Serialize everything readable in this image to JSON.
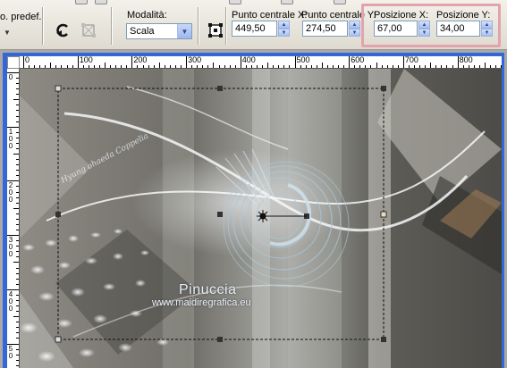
{
  "toolbar": {
    "presets_label": "o. predef.:",
    "mode_label": "Modalità:",
    "mode_value": "Scala",
    "center_x_label": "Punto centrale X:",
    "center_x_value": "449,50",
    "center_y_label": "Punto centrale Y:",
    "center_y_value": "274,50",
    "pos_x_label": "Posizione X:",
    "pos_x_value": "67,00",
    "pos_y_label": "Posizione Y:",
    "pos_y_value": "34,00",
    "highlight_color": "#e3a3ad"
  },
  "ruler": {
    "horizontal_labels": [
      "0",
      "100",
      "200",
      "300",
      "400",
      "500",
      "600",
      "700",
      "800"
    ],
    "vertical_labels": [
      "0",
      "1\n0\n0",
      "2\n0\n0",
      "3\n0\n0",
      "4\n0\n0",
      "5\n0"
    ]
  },
  "canvas": {
    "watermark_name": "Pinuccia",
    "watermark_url": "www.maidiregrafica.eu",
    "script_text": "Hyung ohaeda Coppelia"
  },
  "icons": {
    "presets": "chevron-down-icon",
    "rotate": "rotate-arrow-icon",
    "reset": "reset-transform-icon",
    "anchor": "anchor-box-icon"
  }
}
